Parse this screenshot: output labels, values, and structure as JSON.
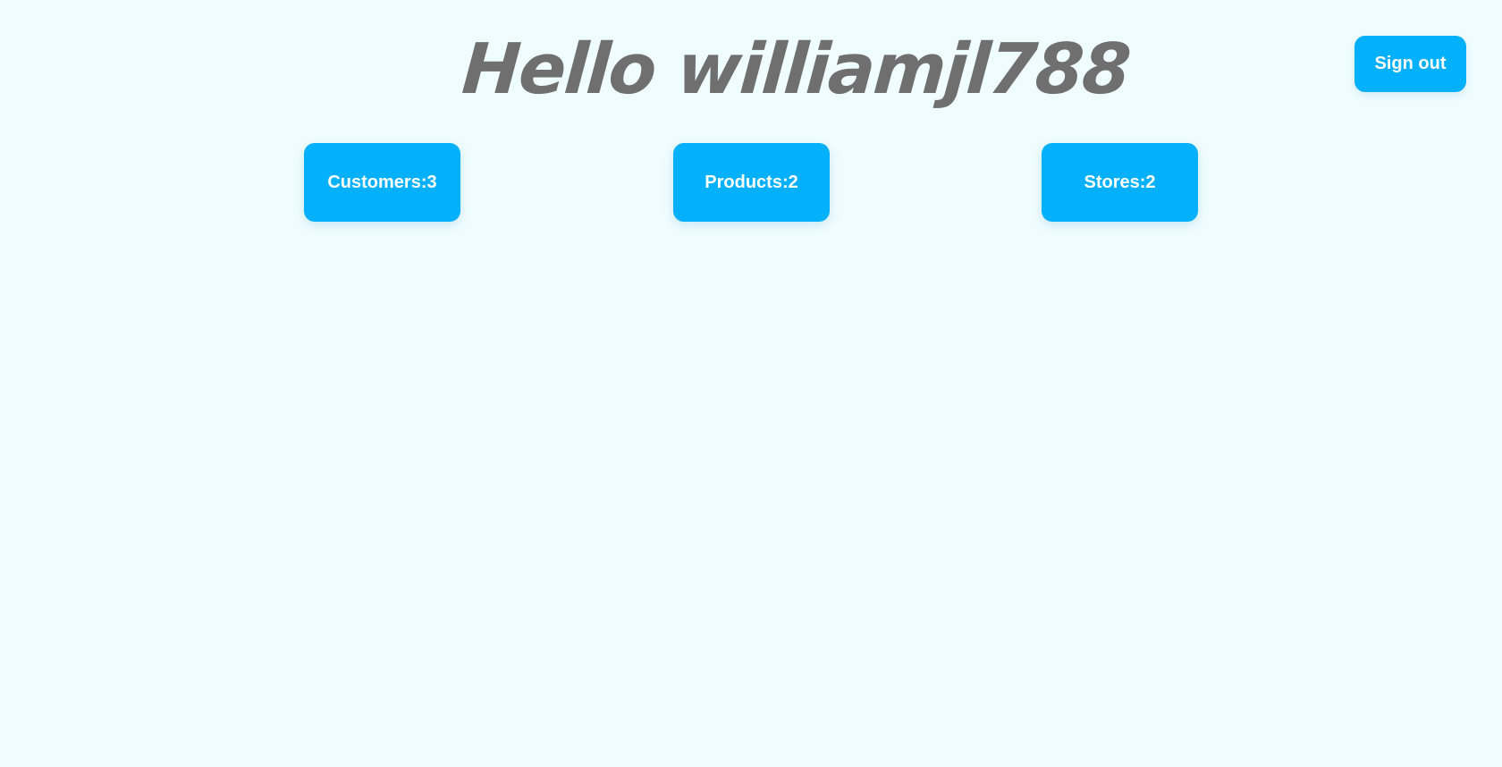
{
  "header": {
    "greeting_prefix": "Hello",
    "username": "williamjl788",
    "greeting": "Hello williamjl788",
    "sign_out_label": "Sign out"
  },
  "stats": {
    "customers": {
      "label": "Customers",
      "count": 3,
      "text": "Customers:3"
    },
    "products": {
      "label": "Products",
      "count": 2,
      "text": "Products:2"
    },
    "stores": {
      "label": "Stores",
      "count": 2,
      "text": "Stores:2"
    }
  },
  "colors": {
    "background": "#f0fdff",
    "accent": "#03b0fc",
    "greeting_text": "#6f6f6f",
    "button_text": "#ffffff"
  }
}
